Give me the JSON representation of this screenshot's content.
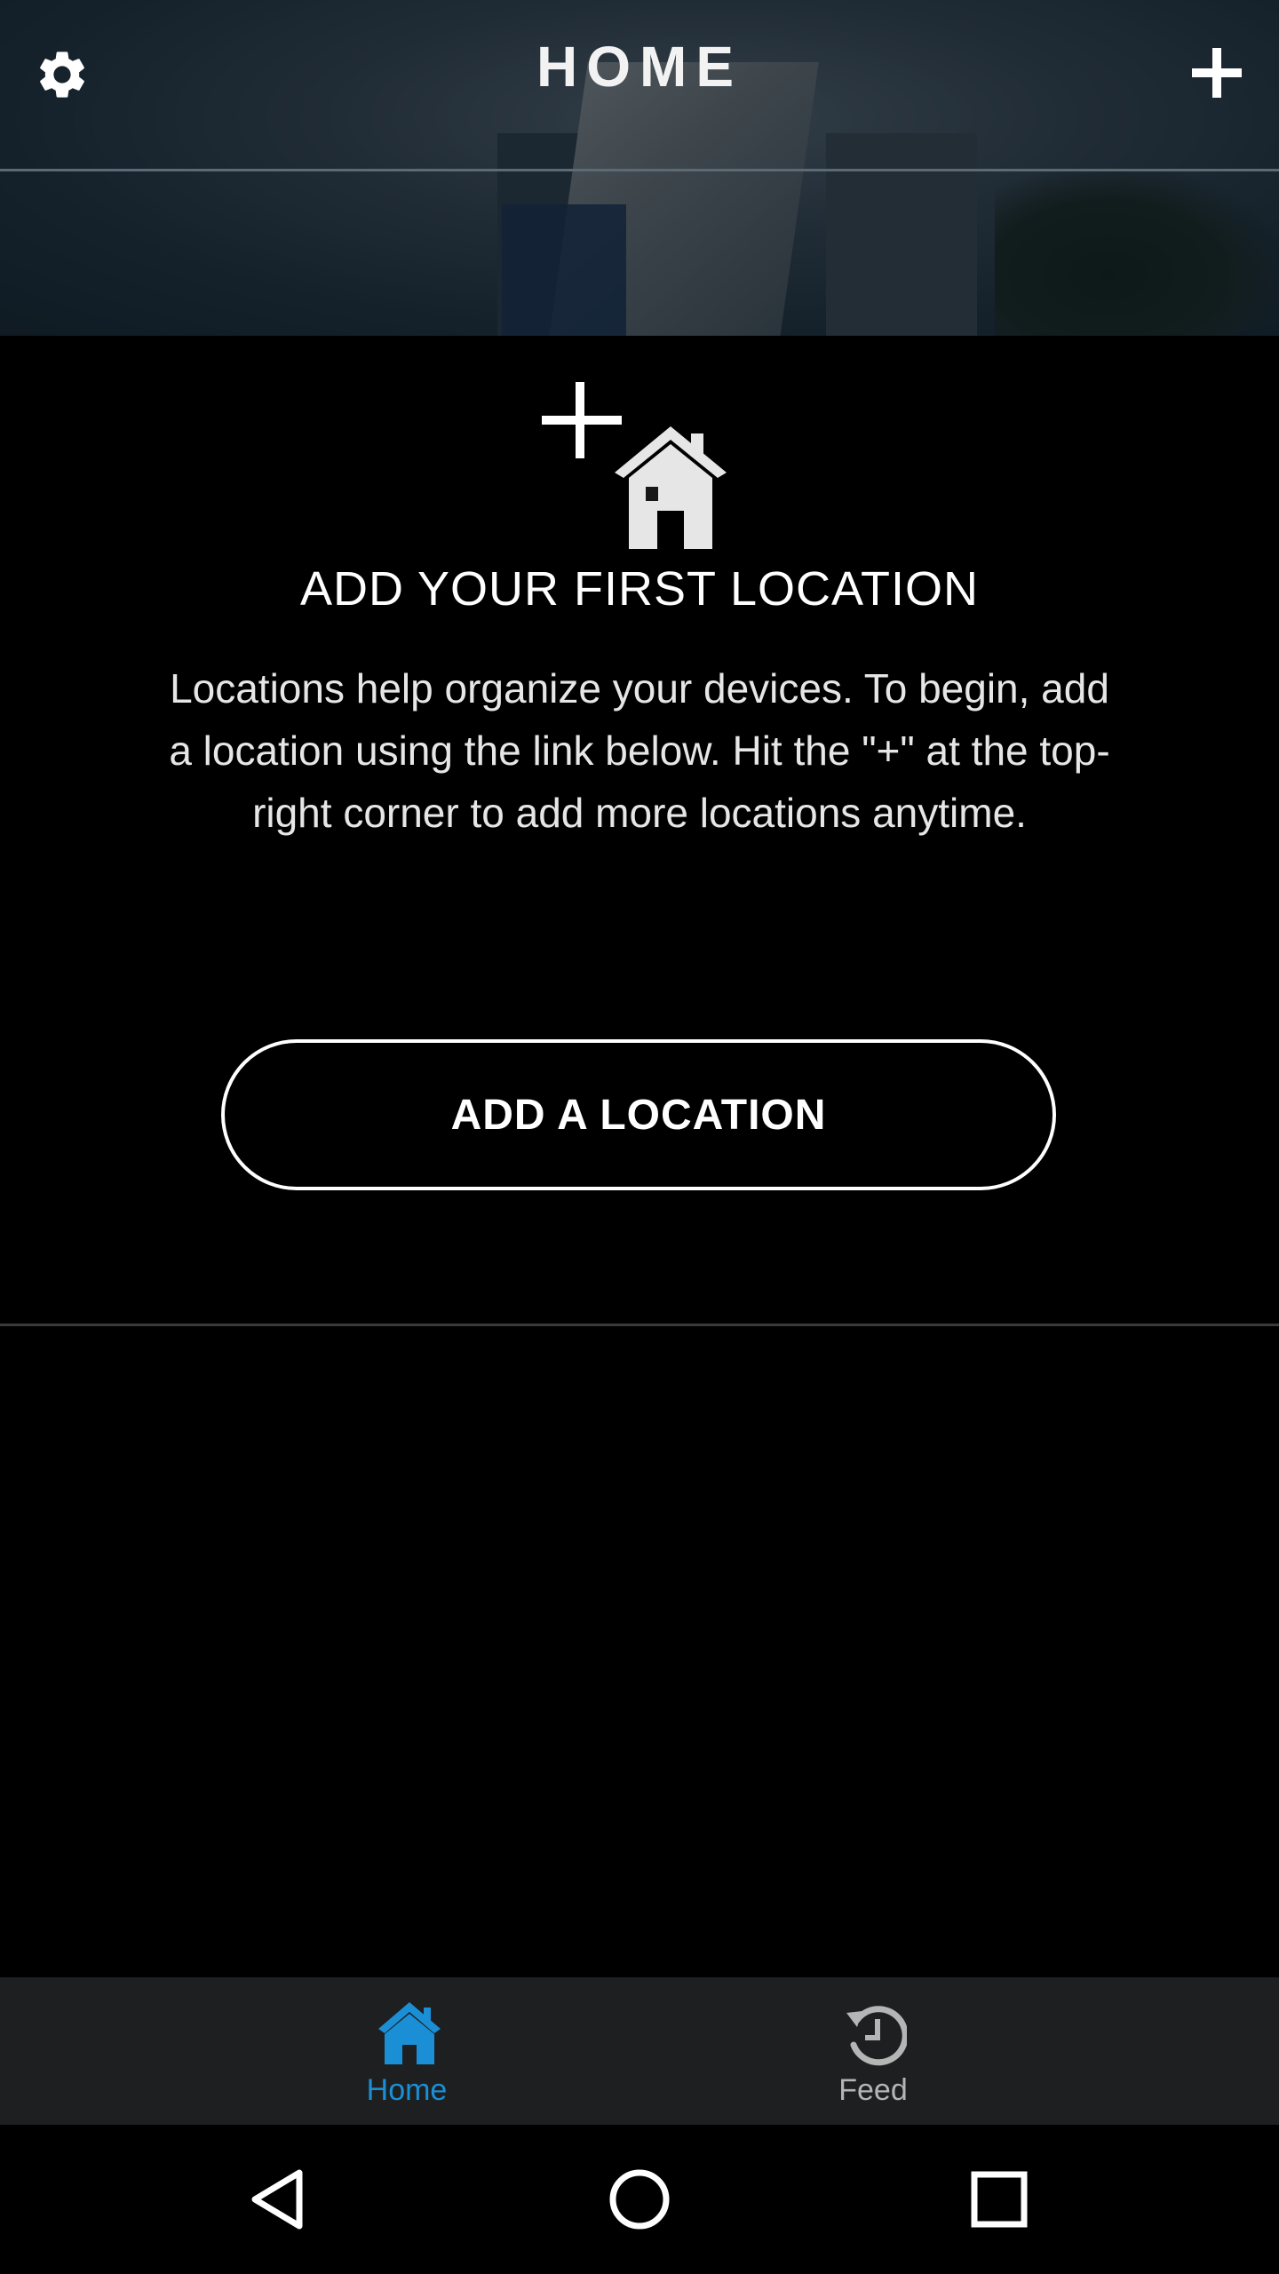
{
  "header": {
    "title": "HOME",
    "settings_icon": "gear-icon",
    "add_icon": "plus-icon"
  },
  "empty_state": {
    "icon": "add-home-icon",
    "heading": "ADD YOUR FIRST LOCATION",
    "description": "Locations help organize your devices. To begin, add a location using the link below. Hit the \"+\" at the top-right corner to add more locations anytime.",
    "button_label": "ADD A LOCATION"
  },
  "tabs": [
    {
      "label": "Home",
      "icon": "home-icon",
      "active": true,
      "color": "#1b8fd6"
    },
    {
      "label": "Feed",
      "icon": "history-icon",
      "active": false,
      "color": "#b5b5b5"
    }
  ],
  "system_nav": {
    "back_icon": "back-triangle-icon",
    "home_icon": "home-circle-icon",
    "recents_icon": "recents-square-icon"
  }
}
